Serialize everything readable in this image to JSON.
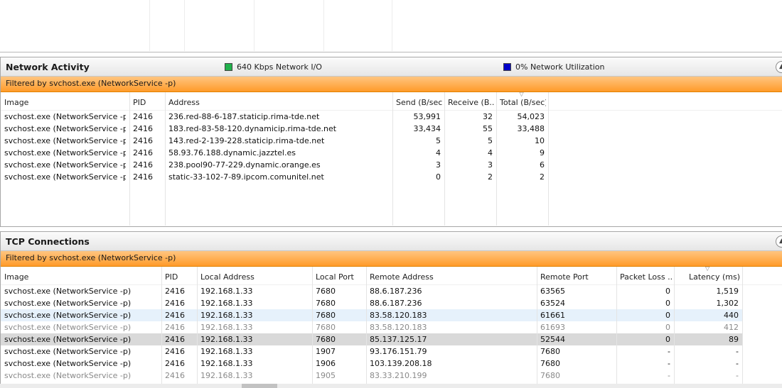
{
  "network": {
    "title": "Network Activity",
    "io_label": "640 Kbps Network I/O",
    "io_color": "#22b14c",
    "util_label": "0% Network Utilization",
    "util_color": "#0000c8",
    "filter": "Filtered by svchost.exe (NetworkService -p)",
    "columns": [
      "Image",
      "PID",
      "Address",
      "Send (B/sec)",
      "Receive (B...",
      "Total (B/sec)"
    ],
    "rows": [
      [
        "svchost.exe (NetworkService -p)",
        "2416",
        "236.red-88-6-187.staticip.rima-tde.net",
        "53,991",
        "32",
        "54,023"
      ],
      [
        "svchost.exe (NetworkService -p)",
        "2416",
        "183.red-83-58-120.dynamicip.rima-tde.net",
        "33,434",
        "55",
        "33,488"
      ],
      [
        "svchost.exe (NetworkService -p)",
        "2416",
        "143.red-2-139-228.staticip.rima-tde.net",
        "5",
        "5",
        "10"
      ],
      [
        "svchost.exe (NetworkService -p)",
        "2416",
        "58.93.76.188.dynamic.jazztel.es",
        "4",
        "4",
        "9"
      ],
      [
        "svchost.exe (NetworkService -p)",
        "2416",
        "238.pool90-77-229.dynamic.orange.es",
        "3",
        "3",
        "6"
      ],
      [
        "svchost.exe (NetworkService -p)",
        "2416",
        "static-33-102-7-89.ipcom.comunitel.net",
        "0",
        "2",
        "2"
      ]
    ]
  },
  "tcp": {
    "title": "TCP Connections",
    "filter": "Filtered by svchost.exe (NetworkService -p)",
    "columns": [
      "Image",
      "PID",
      "Local Address",
      "Local Port",
      "Remote Address",
      "Remote Port",
      "Packet Loss ...",
      "Latency (ms)"
    ],
    "rows": [
      [
        "svchost.exe (NetworkService -p)",
        "2416",
        "192.168.1.33",
        "7680",
        "88.6.187.236",
        "63565",
        "0",
        "1,519"
      ],
      [
        "svchost.exe (NetworkService -p)",
        "2416",
        "192.168.1.33",
        "7680",
        "88.6.187.236",
        "63524",
        "0",
        "1,302"
      ],
      [
        "svchost.exe (NetworkService -p)",
        "2416",
        "192.168.1.33",
        "7680",
        "83.58.120.183",
        "61661",
        "0",
        "440"
      ],
      [
        "svchost.exe (NetworkService -p)",
        "2416",
        "192.168.1.33",
        "7680",
        "83.58.120.183",
        "61693",
        "0",
        "412"
      ],
      [
        "svchost.exe (NetworkService -p)",
        "2416",
        "192.168.1.33",
        "7680",
        "85.137.125.17",
        "52544",
        "0",
        "89"
      ],
      [
        "svchost.exe (NetworkService -p)",
        "2416",
        "192.168.1.33",
        "1907",
        "93.176.151.79",
        "7680",
        "-",
        "-"
      ],
      [
        "svchost.exe (NetworkService -p)",
        "2416",
        "192.168.1.33",
        "1906",
        "103.139.208.18",
        "7680",
        "-",
        "-"
      ],
      [
        "svchost.exe (NetworkService -p)",
        "2416",
        "192.168.1.33",
        "1905",
        "83.33.210.199",
        "7680",
        "-",
        "-"
      ]
    ]
  },
  "icons": {
    "collapse": "chevron-up-icon",
    "sort": "sort-descending-icon"
  }
}
